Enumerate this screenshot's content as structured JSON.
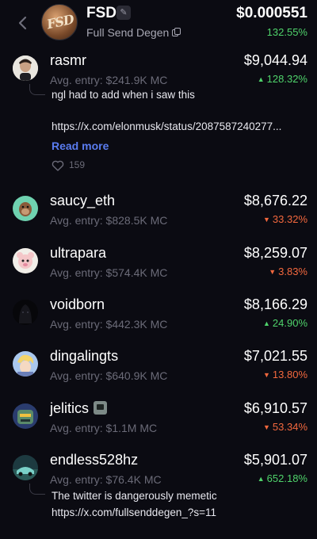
{
  "token": {
    "name": "FSD",
    "subtitle": "Full Send Degen",
    "avatar_text": "FSD",
    "price": "$0.000551",
    "change": "132.55%"
  },
  "colors": {
    "up": "#4fd36b",
    "down": "#f3683e",
    "link": "#5a7cf0",
    "background": "#0b0b12"
  },
  "holders": [
    {
      "username": "rasmr",
      "avg_entry": "Avg. entry: $241.9K MC",
      "value": "$9,044.94",
      "change": "128.32%",
      "direction": "up",
      "comment": "ngl had to add when i saw this",
      "comment_url": "https://x.com/elonmusk/status/2087587240277...",
      "read_more": "Read more",
      "likes": "159"
    },
    {
      "username": "saucy_eth",
      "avg_entry": "Avg. entry: $828.5K MC",
      "value": "$8,676.22",
      "change": "33.32%",
      "direction": "down"
    },
    {
      "username": "ultrapara",
      "avg_entry": "Avg. entry: $574.4K MC",
      "value": "$8,259.07",
      "change": "3.83%",
      "direction": "down"
    },
    {
      "username": "voidborn",
      "avg_entry": "Avg. entry: $442.3K MC",
      "value": "$8,166.29",
      "change": "24.90%",
      "direction": "up"
    },
    {
      "username": "dingalingts",
      "avg_entry": "Avg. entry: $640.9K MC",
      "value": "$7,021.55",
      "change": "13.80%",
      "direction": "down"
    },
    {
      "username": "jelitics",
      "avg_entry": "Avg. entry: $1.1M MC",
      "value": "$6,910.57",
      "change": "53.34%",
      "direction": "down"
    },
    {
      "username": "endless528hz",
      "avg_entry": "Avg. entry: $76.4K MC",
      "value": "$5,901.07",
      "change": "652.18%",
      "direction": "up",
      "comment": "The twitter is dangerously memetic",
      "comment_url": "https://x.com/fullsenddegen_?s=11"
    }
  ],
  "arrows": {
    "up": "▲",
    "down": "▼"
  }
}
